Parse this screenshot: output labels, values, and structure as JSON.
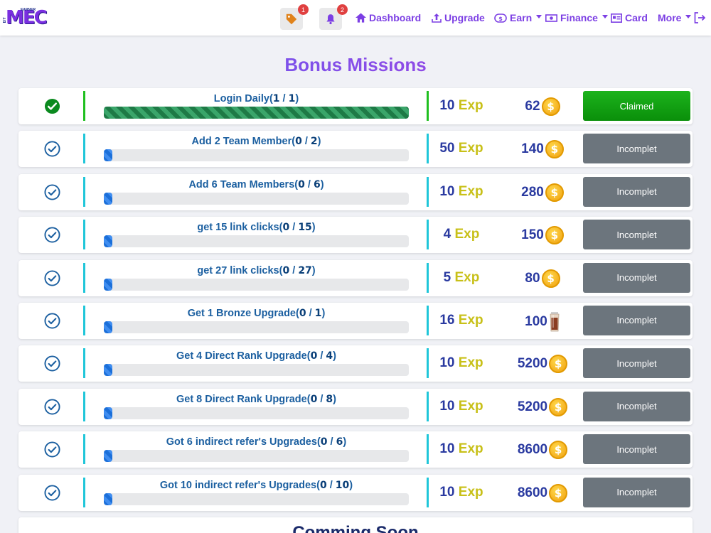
{
  "brand": {
    "logo_main": "MEC",
    "logo_pre": "BY",
    "logo_tag": "EARNER"
  },
  "nav": {
    "tag_badge": "1",
    "bell_badge": "2",
    "dashboard": "Dashboard",
    "upgrade": "Upgrade",
    "earn": "Earn",
    "finance": "Finance",
    "card": "Card",
    "more": "More"
  },
  "page": {
    "title": "Bonus Missions",
    "coming_soon": "Comming Soon"
  },
  "coin_symbol": "$",
  "exp_label": "Exp",
  "missions": [
    {
      "title": "Login Daily",
      "done": "1",
      "total": "1",
      "progress": 1.0,
      "exp": "10",
      "reward": "62",
      "reward_type": "coin",
      "status": "Claimed"
    },
    {
      "title": "Add 2 Team Member",
      "done": "0",
      "total": "2",
      "progress": 0.0,
      "exp": "50",
      "reward": "140",
      "reward_type": "coin",
      "status": "Incomplet"
    },
    {
      "title": "Add 6 Team Members",
      "done": "0",
      "total": "6",
      "progress": 0.0,
      "exp": "10",
      "reward": "280",
      "reward_type": "coin",
      "status": "Incomplet"
    },
    {
      "title": "get 15 link clicks",
      "done": "0",
      "total": "15",
      "progress": 0.0,
      "exp": "4",
      "reward": "150",
      "reward_type": "coin",
      "status": "Incomplet"
    },
    {
      "title": "get 27 link clicks",
      "done": "0",
      "total": "27",
      "progress": 0.0,
      "exp": "5",
      "reward": "80",
      "reward_type": "coin",
      "status": "Incomplet"
    },
    {
      "title": "Get 1 Bronze Upgrade",
      "done": "0",
      "total": "1",
      "progress": 0.0,
      "exp": "16",
      "reward": "100",
      "reward_type": "drink",
      "status": "Incomplet"
    },
    {
      "title": "Get 4 Direct Rank Upgrade",
      "done": "0",
      "total": "4",
      "progress": 0.0,
      "exp": "10",
      "reward": "5200",
      "reward_type": "coin",
      "status": "Incomplet"
    },
    {
      "title": "Get 8 Direct Rank Upgrade",
      "done": "0",
      "total": "8",
      "progress": 0.0,
      "exp": "10",
      "reward": "5200",
      "reward_type": "coin",
      "status": "Incomplet"
    },
    {
      "title": "Got 6 indirect refer's Upgrades",
      "done": "0",
      "total": "6",
      "progress": 0.0,
      "exp": "10",
      "reward": "8600",
      "reward_type": "coin",
      "status": "Incomplet"
    },
    {
      "title": "Got 10 indirect refer's Upgrades",
      "done": "0",
      "total": "10",
      "progress": 0.0,
      "exp": "10",
      "reward": "8600",
      "reward_type": "coin",
      "status": "Incomplet"
    }
  ],
  "colors": {
    "accent": "#7c3fe4",
    "claimed": "#12a312",
    "incomplete": "#6c757d",
    "divider": "#1fc6d9"
  }
}
